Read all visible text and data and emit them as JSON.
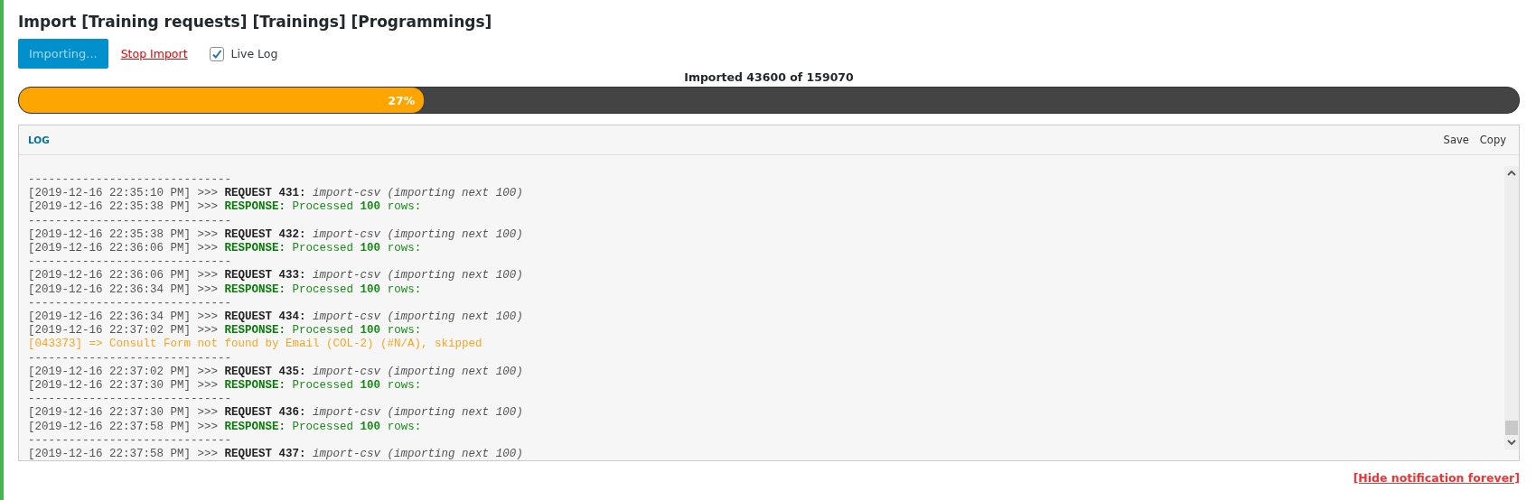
{
  "title": "Import [Training requests] [Trainings] [Programmings]",
  "toolbar": {
    "import_button": {
      "label": "Importing...",
      "disabled": true
    },
    "stop_link": "Stop Import",
    "live_log": {
      "label": "Live Log",
      "checked": true
    }
  },
  "progress": {
    "caption": "Imported 43600 of 159070",
    "level": 0.27,
    "reading": "27%"
  },
  "log": {
    "title": "LOG",
    "actions": [
      "Save",
      "Copy"
    ],
    "lines": [
      {
        "kind": "separator",
        "text": "------------------------------"
      },
      {
        "kind": "request",
        "prefix": "[2019-12-16 22:35:10 PM] >>>",
        "label": "REQUEST 431:",
        "text": "import-csv (importing next 100)"
      },
      {
        "kind": "response",
        "prefix": "[2019-12-16 22:35:38 PM] >>>",
        "label": "RESPONSE:",
        "text": "Processed **100** rows:"
      },
      {
        "kind": "separator",
        "text": "------------------------------"
      },
      {
        "kind": "request",
        "prefix": "[2019-12-16 22:35:38 PM] >>>",
        "label": "REQUEST 432:",
        "text": "import-csv (importing next 100)"
      },
      {
        "kind": "response",
        "prefix": "[2019-12-16 22:36:06 PM] >>>",
        "label": "RESPONSE:",
        "text": "Processed **100** rows:"
      },
      {
        "kind": "separator",
        "text": "------------------------------"
      },
      {
        "kind": "request",
        "prefix": "[2019-12-16 22:36:06 PM] >>>",
        "label": "REQUEST 433:",
        "text": "import-csv (importing next 100)"
      },
      {
        "kind": "response",
        "prefix": "[2019-12-16 22:36:34 PM] >>>",
        "label": "RESPONSE:",
        "text": "Processed **100** rows:"
      },
      {
        "kind": "separator",
        "text": "------------------------------"
      },
      {
        "kind": "request",
        "prefix": "[2019-12-16 22:36:34 PM] >>>",
        "label": "REQUEST 434:",
        "text": "import-csv (importing next 100)"
      },
      {
        "kind": "response",
        "prefix": "[2019-12-16 22:37:02 PM] >>>",
        "label": "RESPONSE:",
        "text": "Processed **100** rows:"
      },
      {
        "kind": "warning",
        "text": "[043373] => Consult Form not found by Email (COL-2) (#N/A), skipped"
      },
      {
        "kind": "separator",
        "text": "------------------------------"
      },
      {
        "kind": "request",
        "prefix": "[2019-12-16 22:37:02 PM] >>>",
        "label": "REQUEST 435:",
        "text": "import-csv (importing next 100)"
      },
      {
        "kind": "response",
        "prefix": "[2019-12-16 22:37:30 PM] >>>",
        "label": "RESPONSE:",
        "text": "Processed **100** rows:"
      },
      {
        "kind": "separator",
        "text": "------------------------------"
      },
      {
        "kind": "request",
        "prefix": "[2019-12-16 22:37:30 PM] >>>",
        "label": "REQUEST 436:",
        "text": "import-csv (importing next 100)"
      },
      {
        "kind": "response",
        "prefix": "[2019-12-16 22:37:58 PM] >>>",
        "label": "RESPONSE:",
        "text": "Processed **100** rows:"
      },
      {
        "kind": "separator",
        "text": "------------------------------"
      },
      {
        "kind": "request",
        "prefix": "[2019-12-16 22:37:58 PM] >>>",
        "label": "REQUEST 437:",
        "text": "import-csv (importing next 100)"
      }
    ]
  },
  "hide_link": "[Hide notification forever]"
}
